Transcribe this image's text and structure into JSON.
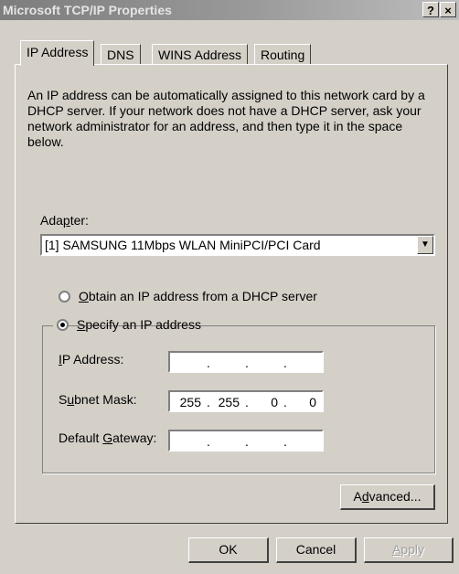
{
  "window": {
    "title": "Microsoft TCP/IP Properties",
    "help_label": "?",
    "close_label": "×"
  },
  "tabs": [
    {
      "label": "IP Address",
      "active": true
    },
    {
      "label": "DNS"
    },
    {
      "label": "WINS Address"
    },
    {
      "label": "Routing"
    }
  ],
  "description": "An IP address can be automatically assigned to this network card by a DHCP server.  If your network does not have a DHCP server, ask your network administrator for an address, and then type it in the space below.",
  "adapter": {
    "label_pre": "Ada",
    "label_u": "p",
    "label_post": "ter:",
    "selected": "[1] SAMSUNG 11Mbps WLAN MiniPCI/PCI Card"
  },
  "radios": {
    "obtain": {
      "label_u": "O",
      "label_rest": "btain an IP address from a DHCP server",
      "checked": false
    },
    "specify": {
      "label_u": "S",
      "label_rest": "pecify an IP address",
      "checked": true
    }
  },
  "fields": {
    "ip_address": {
      "label_u": "I",
      "label_rest": "P Address:",
      "octets": [
        "",
        "",
        "",
        ""
      ]
    },
    "subnet_mask": {
      "label_pre": "S",
      "label_u": "u",
      "label_rest": "bnet Mask:",
      "octets": [
        "255",
        "255",
        "0",
        "0"
      ]
    },
    "default_gateway": {
      "label_pre": "Default ",
      "label_u": "G",
      "label_rest": "ateway:",
      "octets": [
        "",
        "",
        "",
        ""
      ]
    }
  },
  "buttons": {
    "advanced": {
      "label_pre": "A",
      "label_u": "d",
      "label_rest": "vanced..."
    },
    "ok": "OK",
    "cancel": "Cancel",
    "apply": {
      "label_u": "A",
      "label_rest": "pply",
      "enabled": false
    }
  },
  "icons": {
    "dropdown": "chevron-down-icon"
  }
}
